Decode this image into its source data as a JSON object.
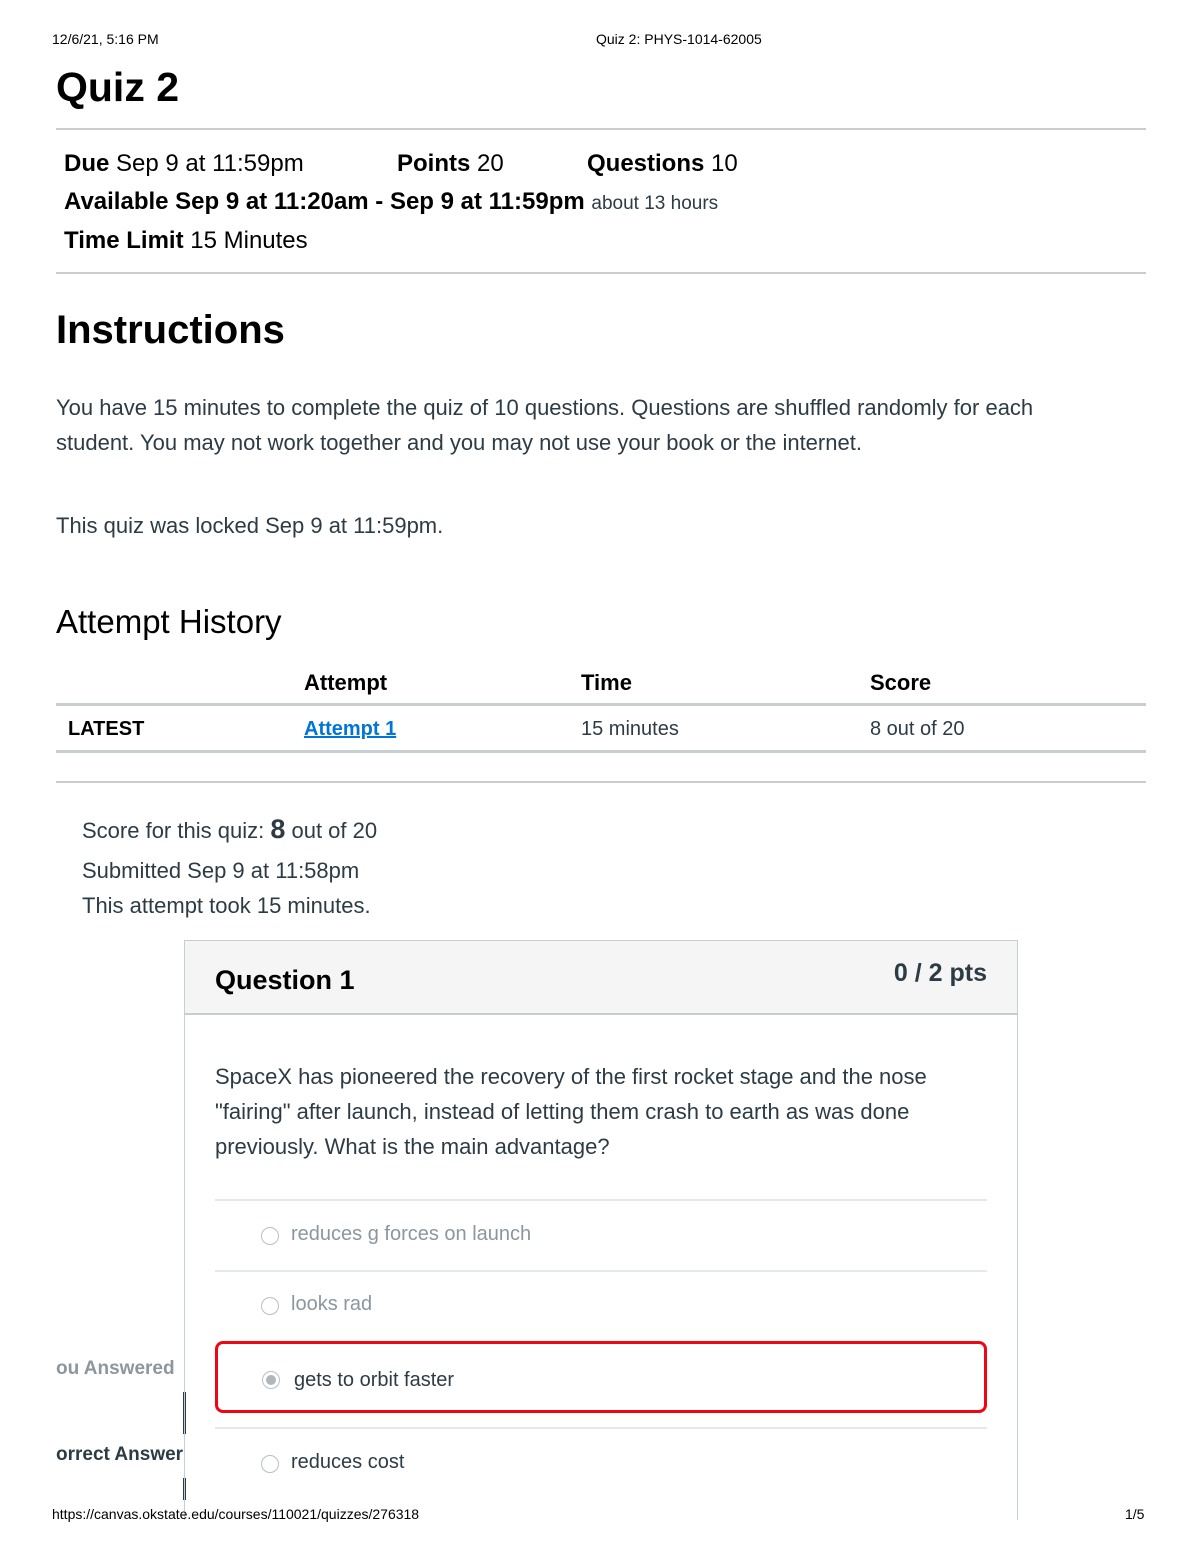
{
  "print_header": {
    "date": "12/6/21, 5:16 PM",
    "title": "Quiz 2: PHYS-1014-62005"
  },
  "print_footer": {
    "url": "https://canvas.okstate.edu/courses/110021/quizzes/276318",
    "page": "1/5"
  },
  "quiz": {
    "title": "Quiz 2",
    "due_label": "Due",
    "due_value": "Sep 9 at 11:59pm",
    "points_label": "Points",
    "points_value": "20",
    "questions_label": "Questions",
    "questions_value": "10",
    "available_label": "Available",
    "available_value": "Sep 9 at 11:20am - Sep 9 at 11:59pm",
    "available_duration": "about 13 hours",
    "time_limit_label": "Time Limit",
    "time_limit_value": "15 Minutes"
  },
  "instructions": {
    "heading": "Instructions",
    "line1": "You have 15 minutes to complete the quiz of 10 questions. Questions are shuffled randomly for each",
    "line2": "student.  You may not work together and you may not use your book or the internet.",
    "locked": "This quiz was locked Sep 9 at 11:59pm."
  },
  "attempt_history": {
    "heading": "Attempt History",
    "columns": [
      "Attempt",
      "Time",
      "Score"
    ],
    "rows": [
      {
        "tag": "LATEST",
        "attempt": "Attempt 1",
        "time": "15 minutes",
        "score": "8 out of 20"
      }
    ]
  },
  "score": {
    "prefix": "Score for this quiz:",
    "value": "8",
    "suffix": "out of 20",
    "submitted": "Submitted Sep 9 at 11:58pm",
    "took": "This attempt took 15 minutes."
  },
  "question1": {
    "name": "Question 1",
    "pts": "0 / 2 pts",
    "line1": "SpaceX has pioneered the recovery of the first rocket stage and the nose",
    "line2": "\"fairing\" after launch, instead of letting them crash to earth as was done",
    "line3": "previously. What is the main advantage?",
    "answers": [
      "reduces g forces on launch",
      "looks rad",
      "gets to orbit faster",
      "reduces cost"
    ],
    "you_answered_label": "ou Answered",
    "correct_answer_label": "orrect Answer"
  },
  "colors": {
    "wrong_highlight": "#ee0612",
    "link": "#0074d9",
    "text": "#2d3b45",
    "rule": "#c7cdd1"
  }
}
